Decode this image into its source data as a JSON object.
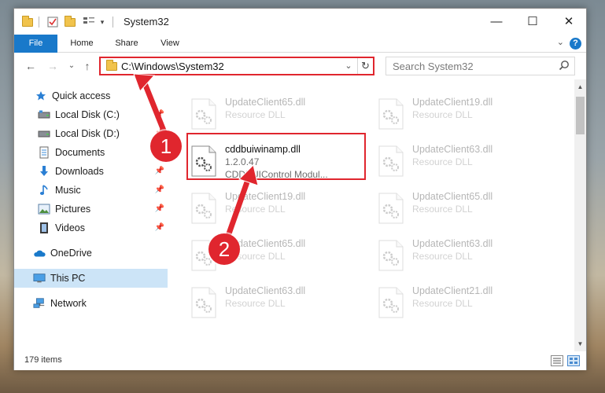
{
  "window": {
    "title": "System32",
    "controls": {
      "minimize": "—",
      "maximize": "☐",
      "close": "✕"
    }
  },
  "ribbon": {
    "tabs": [
      {
        "label": "File"
      },
      {
        "label": "Home"
      },
      {
        "label": "Share"
      },
      {
        "label": "View"
      }
    ],
    "help": "?",
    "minimize": "⌄"
  },
  "nav": {
    "back": "←",
    "forward": "→",
    "recent": "⌄",
    "up": "↑",
    "address": "C:\\Windows\\System32",
    "address_dropdown": "⌄",
    "refresh": "↻",
    "search_placeholder": "Search System32"
  },
  "sidebar": {
    "items": [
      {
        "label": "Quick access",
        "icon": "star-icon"
      },
      {
        "label": "Local Disk (C:)",
        "icon": "drive-icon"
      },
      {
        "label": "Local Disk (D:)",
        "icon": "drive-icon"
      },
      {
        "label": "Documents",
        "icon": "documents-icon"
      },
      {
        "label": "Downloads",
        "icon": "download-icon"
      },
      {
        "label": "Music",
        "icon": "music-icon"
      },
      {
        "label": "Pictures",
        "icon": "pictures-icon"
      },
      {
        "label": "Videos",
        "icon": "videos-icon"
      },
      {
        "label": "OneDrive",
        "icon": "cloud-icon"
      },
      {
        "label": "This PC",
        "icon": "computer-icon"
      },
      {
        "label": "Network",
        "icon": "network-icon"
      }
    ],
    "pin": "📌"
  },
  "files": [
    {
      "name": "UpdateClient65.dll",
      "type": "Resource DLL"
    },
    {
      "name": "UpdateClient19.dll",
      "type": "Resource DLL"
    },
    {
      "name": "cddbuiwinamp.dll",
      "version": "1.2.0.47",
      "desc": "CDDBUIControl Modul..."
    },
    {
      "name": "UpdateClient63.dll",
      "type": "Resource DLL"
    },
    {
      "name": "UpdateClient19.dll",
      "type": "Resource DLL"
    },
    {
      "name": "UpdateClient65.dll",
      "type": "Resource DLL"
    },
    {
      "name": "UpdateClient65.dll",
      "type": "Resource DLL"
    },
    {
      "name": "UpdateClient63.dll",
      "type": "Resource DLL"
    },
    {
      "name": "UpdateClient63.dll",
      "type": "Resource DLL"
    },
    {
      "name": "UpdateClient21.dll",
      "type": "Resource DLL"
    }
  ],
  "status": {
    "items": "179 items"
  },
  "annotations": {
    "step1": "1",
    "step2": "2"
  },
  "colors": {
    "accent": "#1979ca",
    "highlight": "#e0262e",
    "selected": "#cce4f7"
  }
}
